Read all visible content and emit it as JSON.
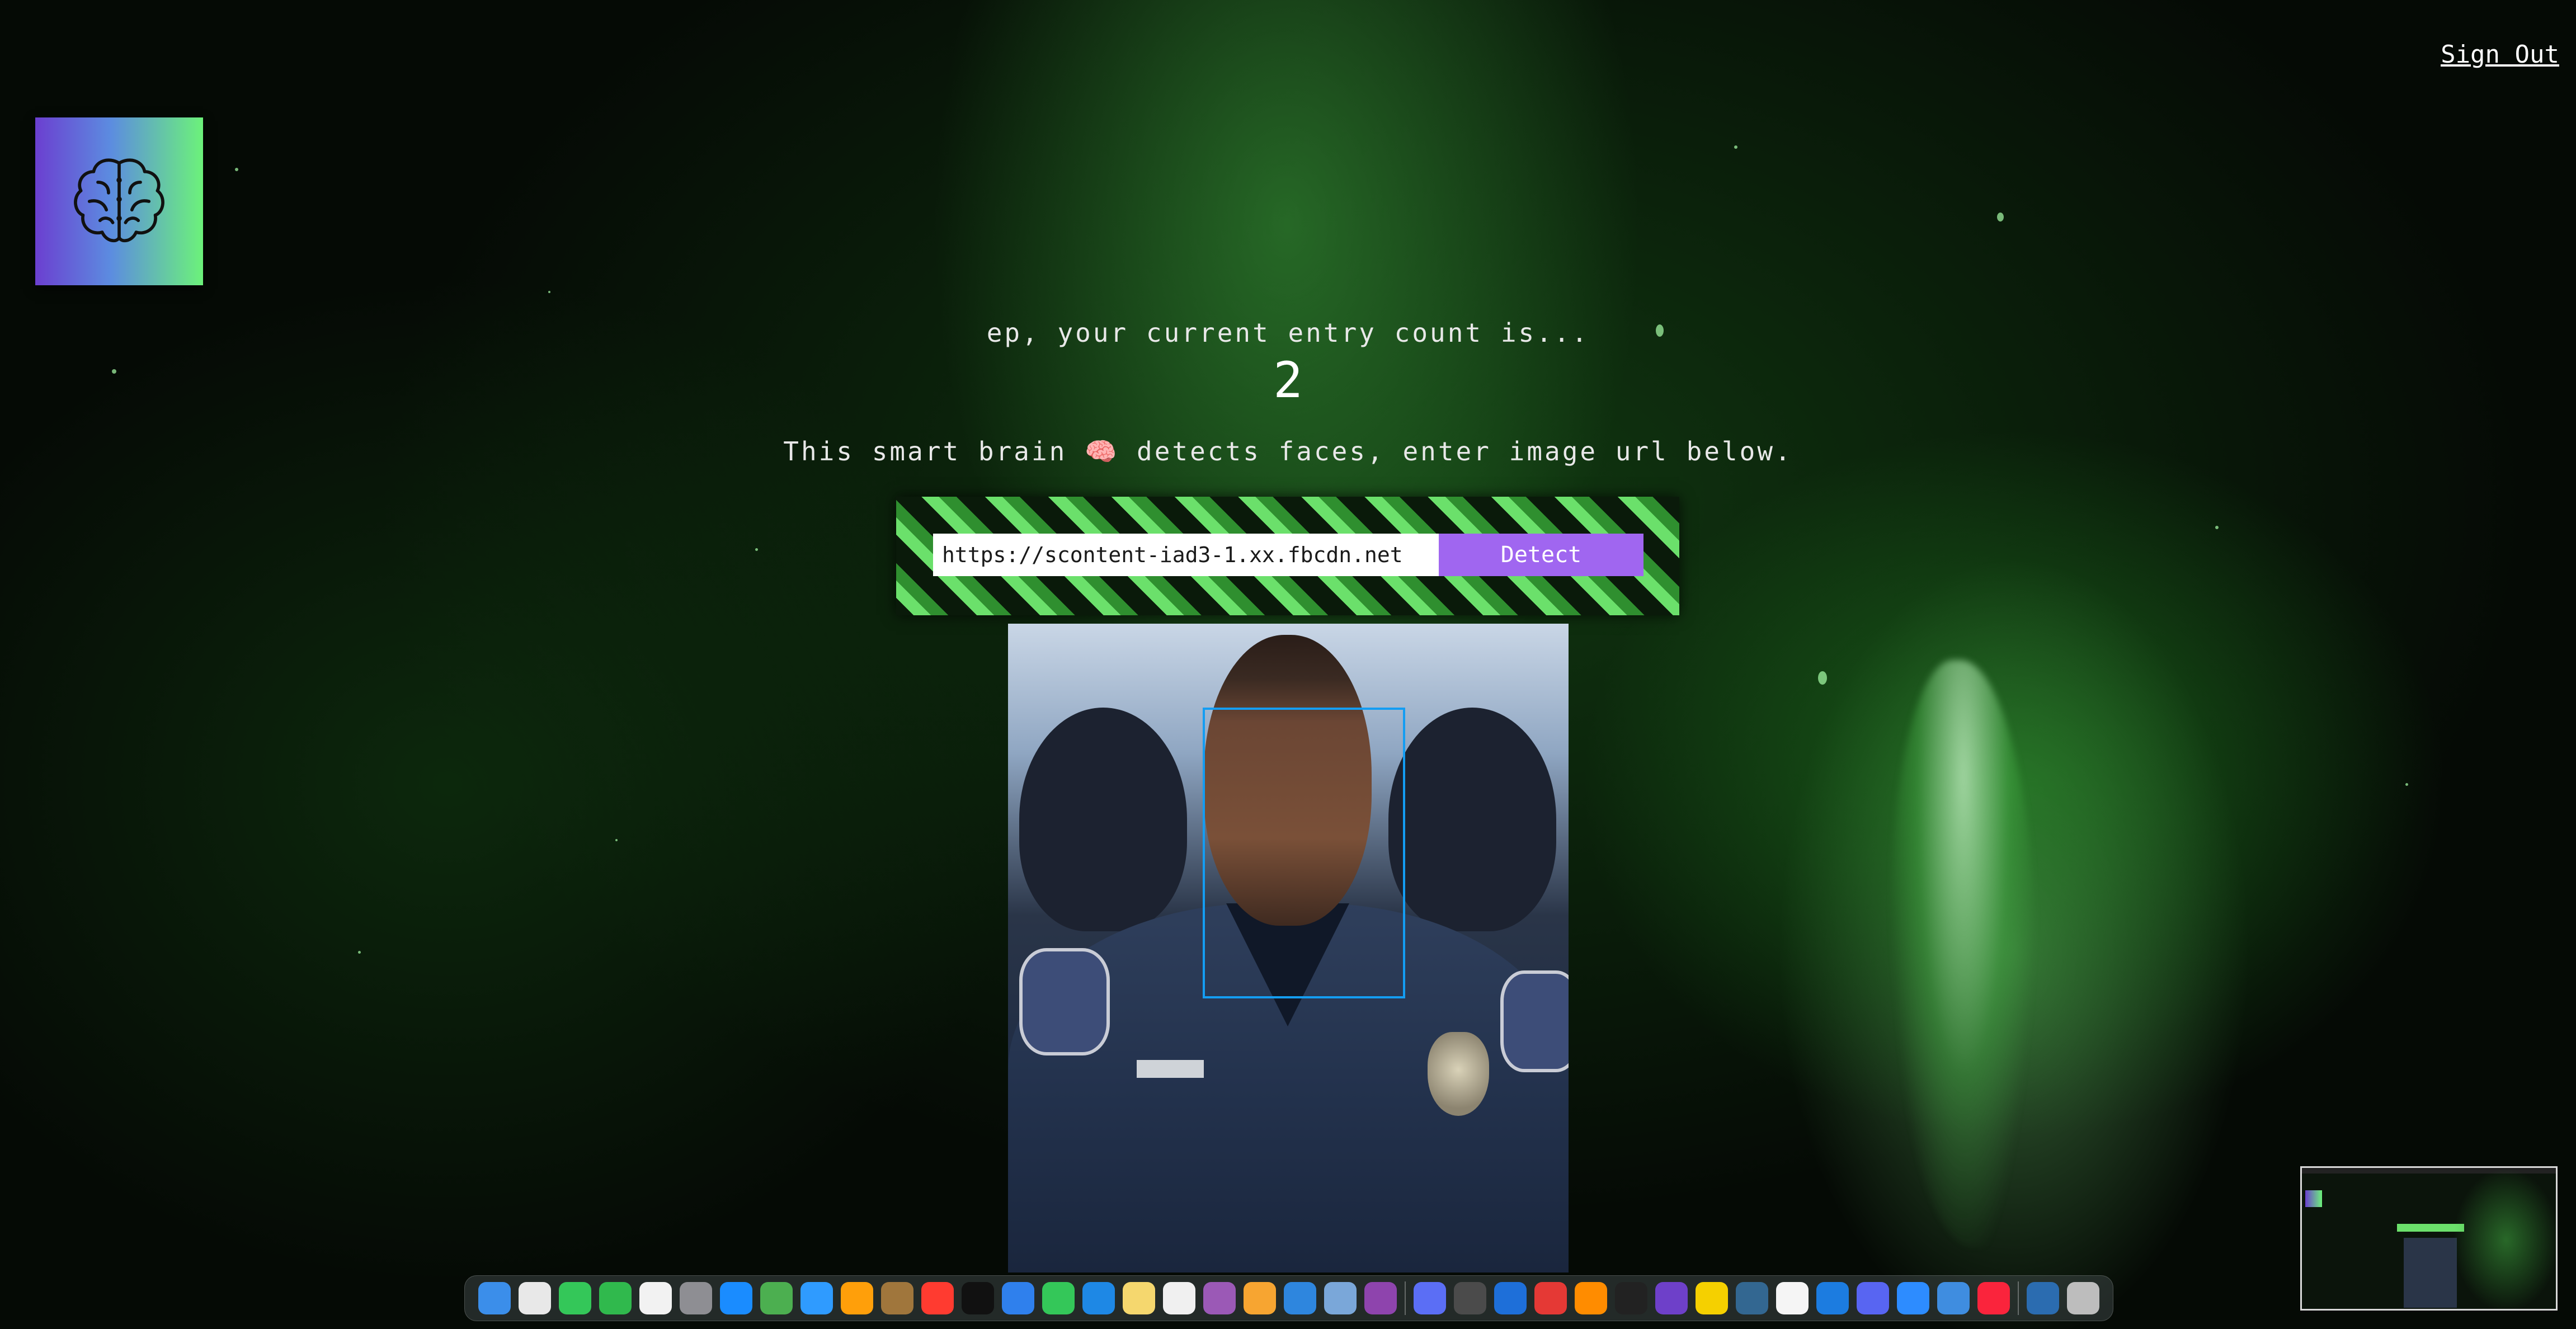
{
  "header": {
    "sign_out_label": "Sign Out"
  },
  "logo": {
    "icon": "brain-icon"
  },
  "rank": {
    "entry_line": "ep, your current entry count is...",
    "entry_count": "2"
  },
  "tagline": "This smart brain 🧠 detects faces, enter image url below.",
  "form": {
    "url_value": "https://scontent-iad3-1.xx.fbcdn.net",
    "detect_label": "Detect"
  },
  "result": {
    "face_box_color": "#149df2"
  },
  "colors": {
    "accent_button": "#a066f0",
    "logo_gradient_start": "#6b3fd0",
    "logo_gradient_end": "#6cf27a"
  },
  "dock": {
    "apps": [
      "finder-icon",
      "launchpad-icon",
      "messages-icon",
      "facetime-icon",
      "reminders-icon",
      "system-settings-icon",
      "app-store-icon",
      "maps-icon",
      "safari-icon",
      "photos-icon",
      "notes-brown-icon",
      "news-icon",
      "apple-tv-icon",
      "mail-icon",
      "numbers-icon",
      "keynote-icon",
      "notes-icon",
      "freeform-icon",
      "podcasts-icon",
      "pages-icon",
      "bluetooth-icon",
      "preview-icon",
      "feedback-icon",
      "messenger-icon",
      "quicktime-icon",
      "vscode-icon",
      "chrome-icon",
      "sublime-text-icon",
      "terminal-icon",
      "github-icon",
      "stickies-icon",
      "postgres-icon",
      "textedit-icon",
      "xcode-icon",
      "discord-icon",
      "zoom-icon",
      "finder-alt-icon",
      "music-icon",
      "network-icon",
      "trash-icon"
    ]
  }
}
